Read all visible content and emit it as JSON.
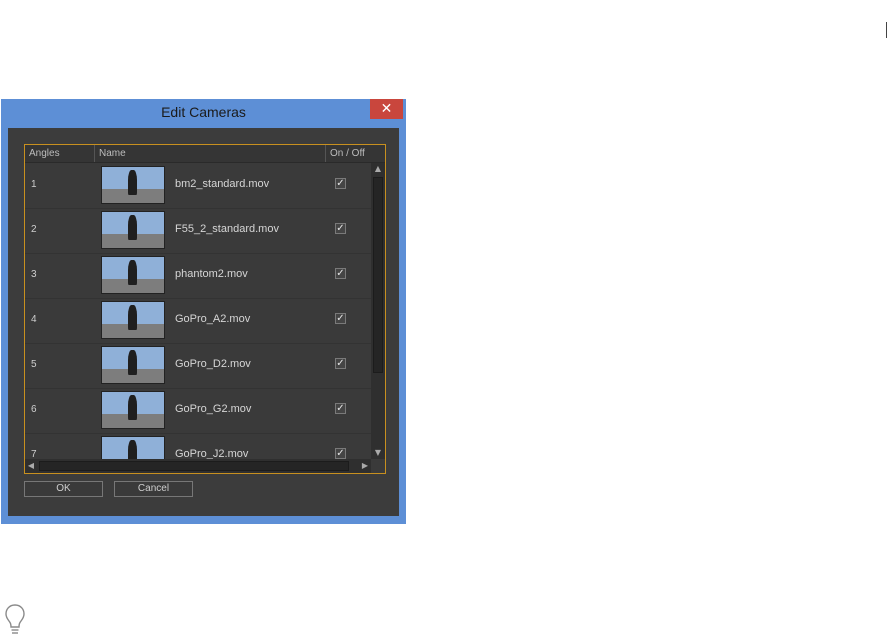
{
  "dialog": {
    "title": "Edit Cameras",
    "close_glyph": "✕",
    "columns": {
      "angles": "Angles",
      "name": "Name",
      "onoff": "On / Off"
    },
    "rows": [
      {
        "angle": "1",
        "name": "bm2_standard.mov",
        "checked": true
      },
      {
        "angle": "2",
        "name": "F55_2_standard.mov",
        "checked": true
      },
      {
        "angle": "3",
        "name": "phantom2.mov",
        "checked": true
      },
      {
        "angle": "4",
        "name": "GoPro_A2.mov",
        "checked": true
      },
      {
        "angle": "5",
        "name": "GoPro_D2.mov",
        "checked": true
      },
      {
        "angle": "6",
        "name": "GoPro_G2.mov",
        "checked": true
      },
      {
        "angle": "7",
        "name": "GoPro_J2.mov",
        "checked": true
      }
    ],
    "check_glyph": "✓",
    "scroll": {
      "up": "▲",
      "down": "▼",
      "left": "◀",
      "right": "▶"
    },
    "buttons": {
      "ok": "OK",
      "cancel": "Cancel"
    }
  },
  "icons": {
    "hint": "lightbulb-icon"
  },
  "colors": {
    "title_bar": "#5d8fd6",
    "close_button": "#c9463d",
    "client_bg": "#3c3c3c",
    "panel_border": "#c8901f"
  }
}
